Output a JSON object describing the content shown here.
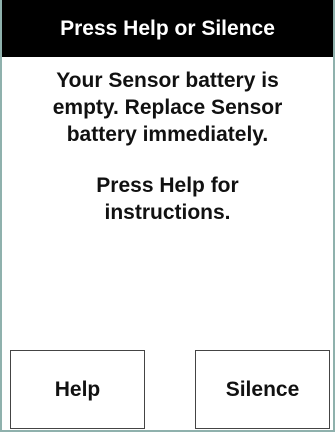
{
  "header": {
    "title": "Press Help or Silence"
  },
  "message": {
    "lines": [
      "Your Sensor battery is",
      "empty. Replace Sensor",
      "battery immediately."
    ],
    "instruction_lines": [
      "Press Help for",
      "instructions."
    ]
  },
  "buttons": {
    "help_label": "Help",
    "silence_label": "Silence"
  },
  "colors": {
    "header_bg": "#000000",
    "header_text": "#ffffff",
    "border": "#8fb1ad"
  }
}
